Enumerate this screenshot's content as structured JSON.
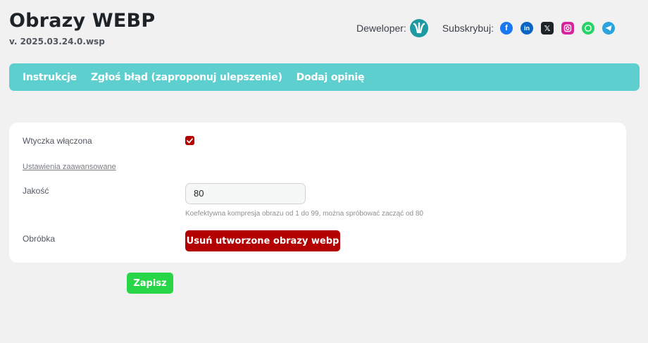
{
  "header": {
    "title": "Obrazy WEBP",
    "version": "v. 2025.03.24.0.wsp",
    "developer_label": "Deweloper:",
    "subscribe_label": "Subskrybuj:",
    "developer_logo_icon": "developer-logo-icon",
    "social_icons": [
      "facebook-icon",
      "linkedin-icon",
      "x-icon",
      "instagram-icon",
      "whatsapp-icon",
      "telegram-icon"
    ]
  },
  "nav": {
    "items": [
      {
        "label": "Instrukcje"
      },
      {
        "label": "Zgłoś błąd (zaproponuj ulepszenie)"
      },
      {
        "label": "Dodaj opinię"
      }
    ]
  },
  "settings": {
    "plugin_enabled_label": "Wtyczka włączona",
    "plugin_enabled_checked": true,
    "advanced_link": "Ustawienia zaawansowane",
    "quality_label": "Jakość",
    "quality_value": "80",
    "quality_help": "Koefektywna kompresja obrazu od 1 do 99, można spróbować zacząć od 80",
    "processing_label": "Obróbka",
    "delete_button": "Usuń utworzone obrazy webp"
  },
  "save_button": "Zapisz",
  "colors": {
    "nav_bg": "#5ecfcf",
    "danger": "#b30000",
    "save": "#28d648"
  }
}
